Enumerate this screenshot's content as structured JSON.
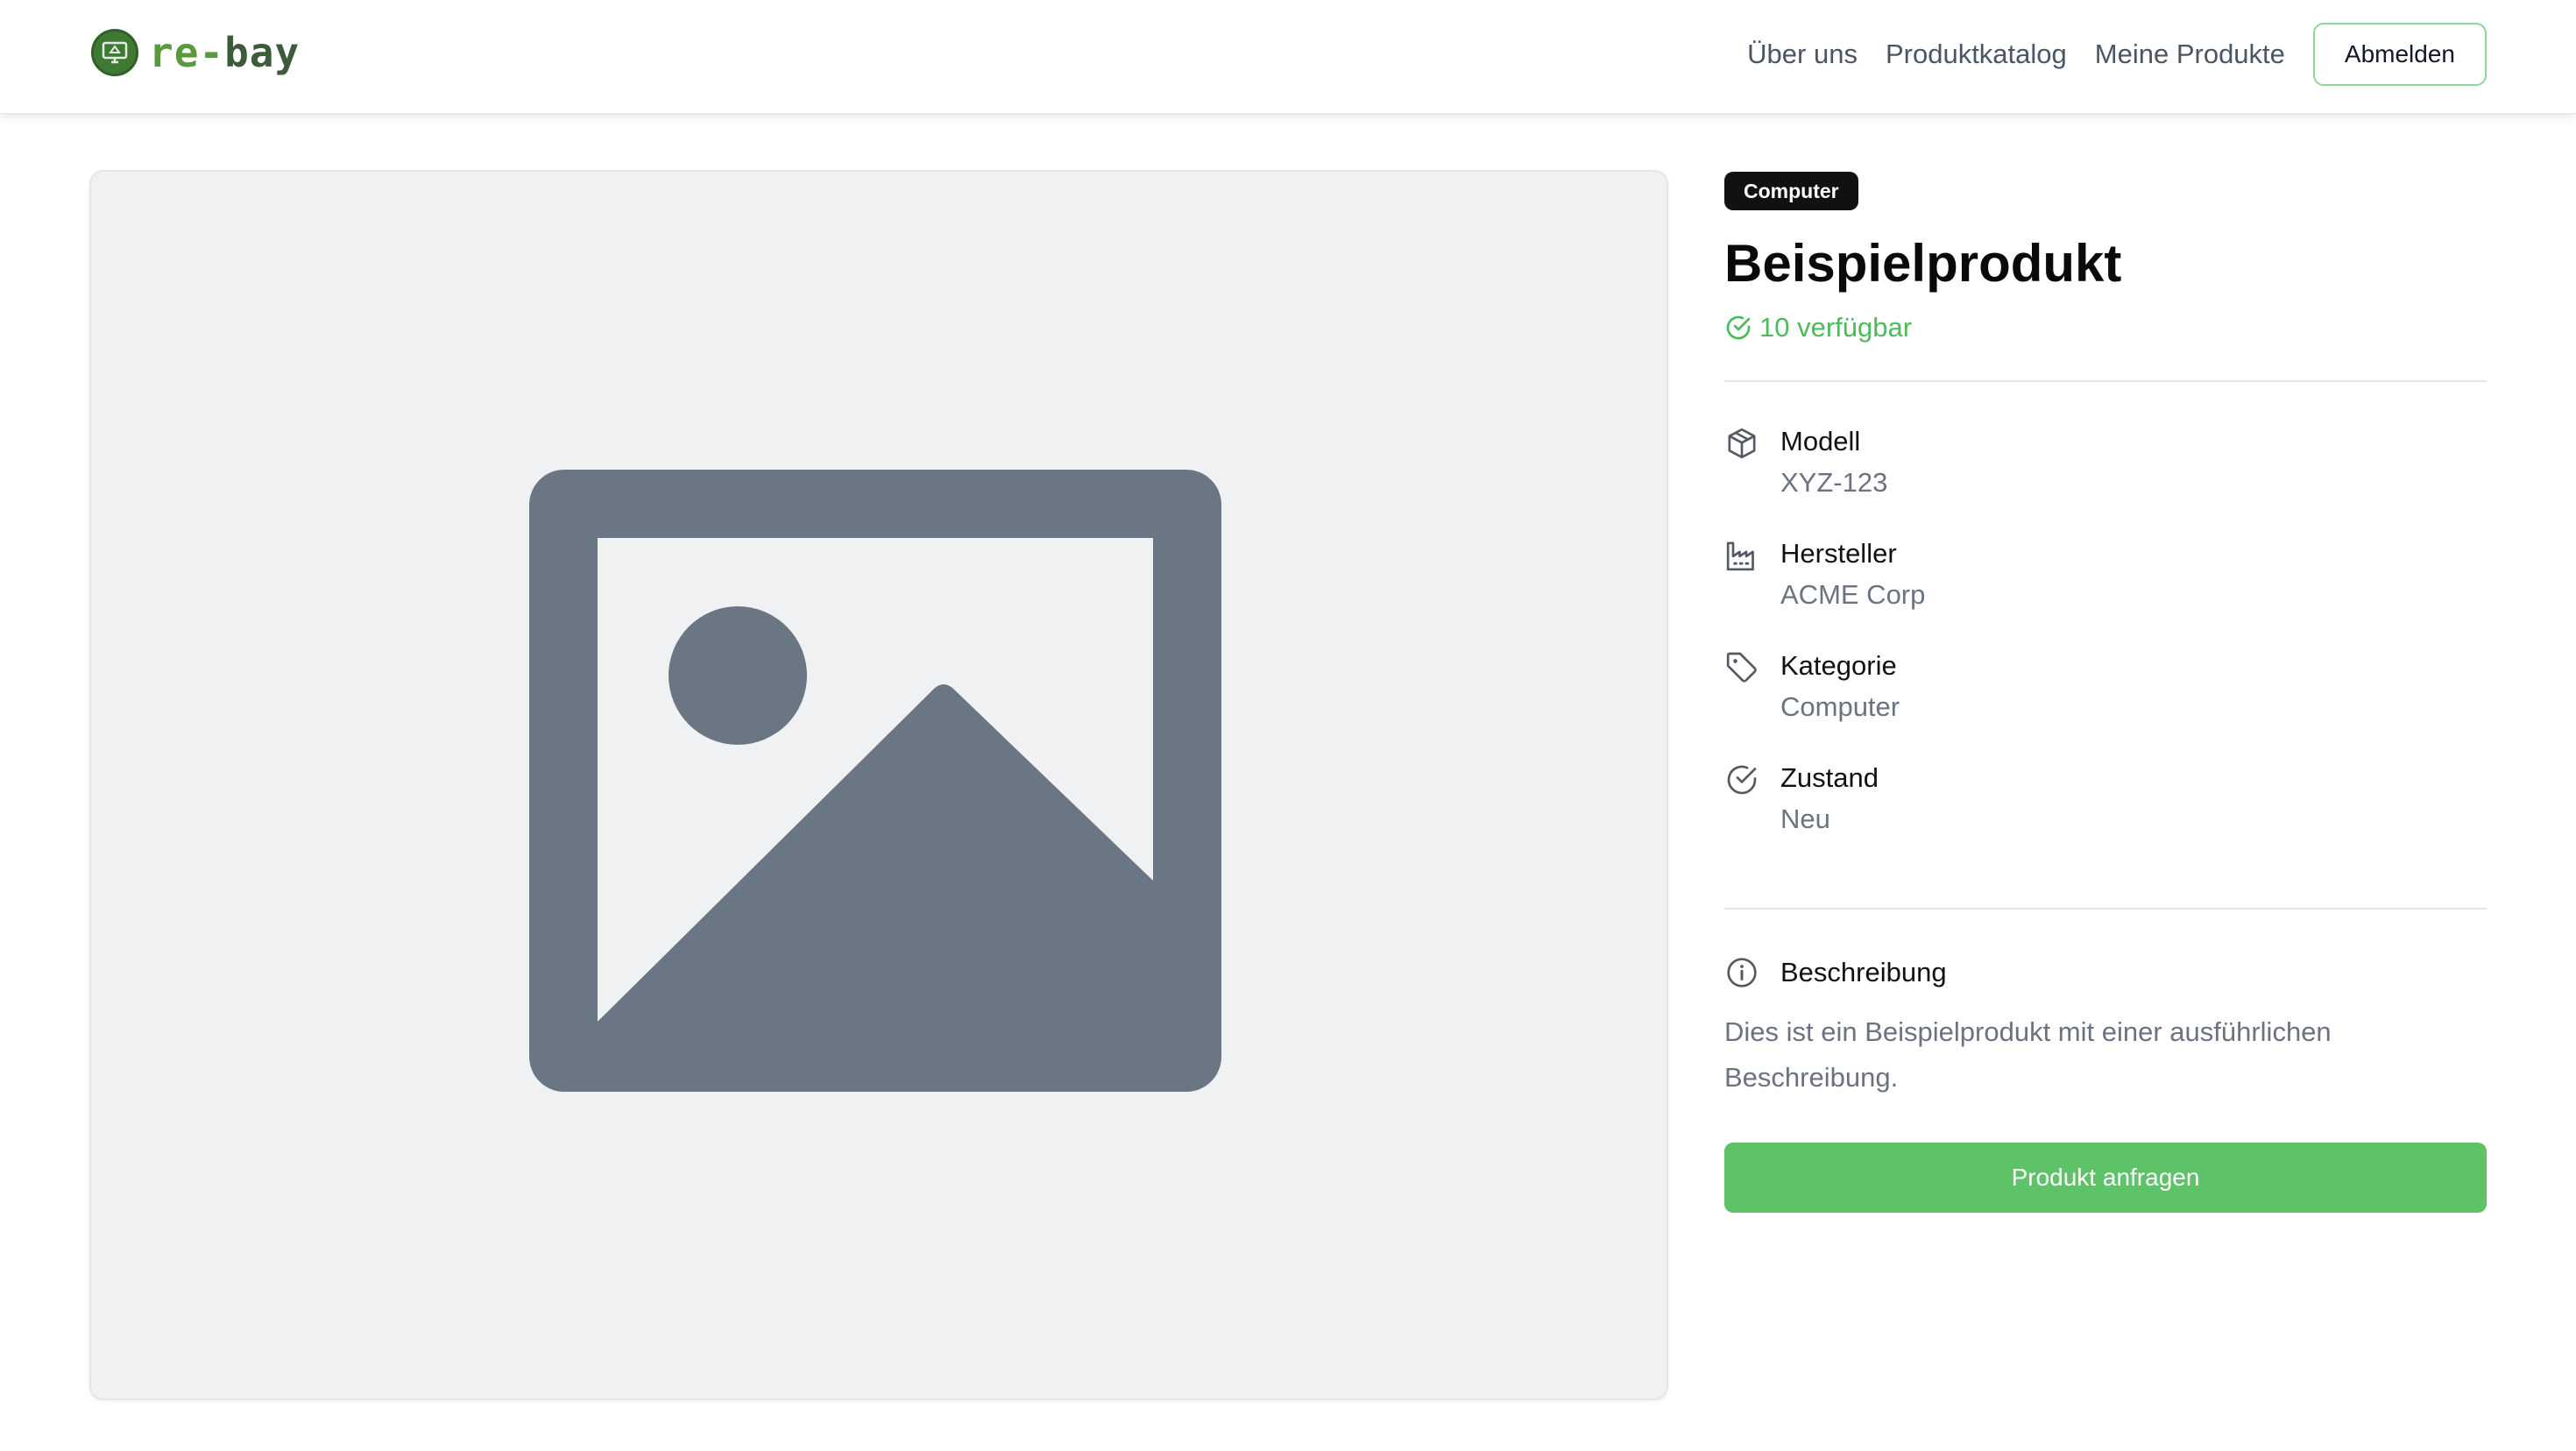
{
  "brand": {
    "name_part1": "re-",
    "name_part2": "bay",
    "accent": "#5ec269"
  },
  "nav": {
    "links": [
      "Über uns",
      "Produktkatalog",
      "Meine Produkte"
    ],
    "logout_label": "Abmelden"
  },
  "product": {
    "category_badge": "Computer",
    "title": "Beispielprodukt",
    "availability": "10 verfügbar",
    "specs": [
      {
        "icon": "package-icon",
        "label": "Modell",
        "value": "XYZ-123"
      },
      {
        "icon": "factory-icon",
        "label": "Hersteller",
        "value": "ACME Corp"
      },
      {
        "icon": "tag-icon",
        "label": "Kategorie",
        "value": "Computer"
      },
      {
        "icon": "check-circle-icon",
        "label": "Zustand",
        "value": "Neu"
      }
    ],
    "description_title": "Beschreibung",
    "description": "Dies ist ein Beispielprodukt mit einer ausführlichen Beschreibung.",
    "cta_label": "Produkt anfragen"
  }
}
